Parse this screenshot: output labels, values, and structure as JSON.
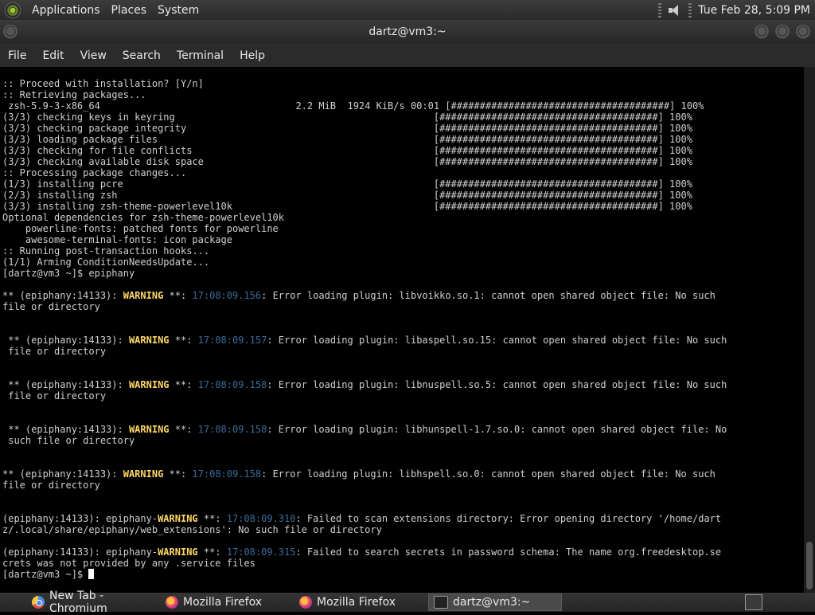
{
  "top_panel": {
    "menus": [
      "Applications",
      "Places",
      "System"
    ],
    "clock": "Tue Feb 28,  5:09 PM"
  },
  "window": {
    "title": "dartz@vm3:~",
    "menu": [
      "File",
      "Edit",
      "View",
      "Search",
      "Terminal",
      "Help"
    ]
  },
  "terminal": {
    "lines": [
      [
        {
          "t": ":: Proceed with installation? [Y/n]"
        }
      ],
      [
        {
          "t": ":: Retrieving packages..."
        }
      ],
      [
        {
          "t": " zsh-5.9-3-x86_64                                  2.2 MiB  1924 KiB/s 00:01 [######################################] 100%"
        }
      ],
      [
        {
          "t": "(3/3) checking keys in keyring                                             [######################################] 100%"
        }
      ],
      [
        {
          "t": "(3/3) checking package integrity                                           [######################################] 100%"
        }
      ],
      [
        {
          "t": "(3/3) loading package files                                                [######################################] 100%"
        }
      ],
      [
        {
          "t": "(3/3) checking for file conflicts                                          [######################################] 100%"
        }
      ],
      [
        {
          "t": "(3/3) checking available disk space                                        [######################################] 100%"
        }
      ],
      [
        {
          "t": ":: Processing package changes..."
        }
      ],
      [
        {
          "t": "(1/3) installing pcre                                                      [######################################] 100%"
        }
      ],
      [
        {
          "t": "(2/3) installing zsh                                                       [######################################] 100%"
        }
      ],
      [
        {
          "t": "(3/3) installing zsh-theme-powerlevel10k                                   [######################################] 100%"
        }
      ],
      [
        {
          "t": "Optional dependencies for zsh-theme-powerlevel10k"
        }
      ],
      [
        {
          "t": "    powerline-fonts: patched fonts for powerline"
        }
      ],
      [
        {
          "t": "    awesome-terminal-fonts: icon package"
        }
      ],
      [
        {
          "t": ":: Running post-transaction hooks..."
        }
      ],
      [
        {
          "t": "(1/1) Arming ConditionNeedsUpdate..."
        }
      ],
      [
        {
          "t": "[dartz@vm3 ~]$ epiphany"
        }
      ],
      [
        {
          "t": ""
        }
      ],
      [
        {
          "t": "** (epiphany:14133): "
        },
        {
          "t": "WARNING",
          "c": "warn"
        },
        {
          "t": " **: "
        },
        {
          "t": "17:08:09.156",
          "c": "ts"
        },
        {
          "t": ": Error loading plugin: libvoikko.so.1: cannot open shared object file: No such"
        }
      ],
      [
        {
          "t": "file or directory"
        }
      ],
      [
        {
          "t": ""
        }
      ],
      [
        {
          "t": ""
        }
      ],
      [
        {
          "t": " ** (epiphany:14133): "
        },
        {
          "t": "WARNING",
          "c": "warn"
        },
        {
          "t": " **: "
        },
        {
          "t": "17:08:09.157",
          "c": "ts"
        },
        {
          "t": ": Error loading plugin: libaspell.so.15: cannot open shared object file: No such"
        }
      ],
      [
        {
          "t": " file or directory"
        }
      ],
      [
        {
          "t": ""
        }
      ],
      [
        {
          "t": ""
        }
      ],
      [
        {
          "t": " ** (epiphany:14133): "
        },
        {
          "t": "WARNING",
          "c": "warn"
        },
        {
          "t": " **: "
        },
        {
          "t": "17:08:09.158",
          "c": "ts"
        },
        {
          "t": ": Error loading plugin: libnuspell.so.5: cannot open shared object file: No such"
        }
      ],
      [
        {
          "t": " file or directory"
        }
      ],
      [
        {
          "t": ""
        }
      ],
      [
        {
          "t": ""
        }
      ],
      [
        {
          "t": " ** (epiphany:14133): "
        },
        {
          "t": "WARNING",
          "c": "warn"
        },
        {
          "t": " **: "
        },
        {
          "t": "17:08:09.158",
          "c": "ts"
        },
        {
          "t": ": Error loading plugin: libhunspell-1.7.so.0: cannot open shared object file: No"
        }
      ],
      [
        {
          "t": " such file or directory"
        }
      ],
      [
        {
          "t": ""
        }
      ],
      [
        {
          "t": ""
        }
      ],
      [
        {
          "t": "** (epiphany:14133): "
        },
        {
          "t": "WARNING",
          "c": "warn"
        },
        {
          "t": " **: "
        },
        {
          "t": "17:08:09.158",
          "c": "ts"
        },
        {
          "t": ": Error loading plugin: libhspell.so.0: cannot open shared object file: No such"
        }
      ],
      [
        {
          "t": "file or directory"
        }
      ],
      [
        {
          "t": ""
        }
      ],
      [
        {
          "t": ""
        }
      ],
      [
        {
          "t": "(epiphany:14133): epiphany-"
        },
        {
          "t": "WARNING",
          "c": "warn"
        },
        {
          "t": " **: "
        },
        {
          "t": "17:08:09.310",
          "c": "ts"
        },
        {
          "t": ": Failed to scan extensions directory: Error opening directory '/home/dart"
        }
      ],
      [
        {
          "t": "z/.local/share/epiphany/web_extensions': No such file or directory"
        }
      ],
      [
        {
          "t": ""
        }
      ],
      [
        {
          "t": "(epiphany:14133): epiphany-"
        },
        {
          "t": "WARNING",
          "c": "warn"
        },
        {
          "t": " **: "
        },
        {
          "t": "17:08:09.315",
          "c": "ts"
        },
        {
          "t": ": Failed to search secrets in password schema: The name org.freedesktop.se"
        }
      ],
      [
        {
          "t": "crets was not provided by any .service files"
        }
      ],
      [
        {
          "t": "[dartz@vm3 ~]$ "
        }
      ]
    ]
  },
  "taskbar": {
    "tasks": [
      {
        "label": "New Tab - Chromium",
        "icon": "chromium-icon"
      },
      {
        "label": "Mozilla Firefox",
        "icon": "firefox-icon"
      },
      {
        "label": "Mozilla Firefox",
        "icon": "firefox-icon"
      },
      {
        "label": "dartz@vm3:~",
        "icon": "terminal-icon"
      }
    ]
  }
}
